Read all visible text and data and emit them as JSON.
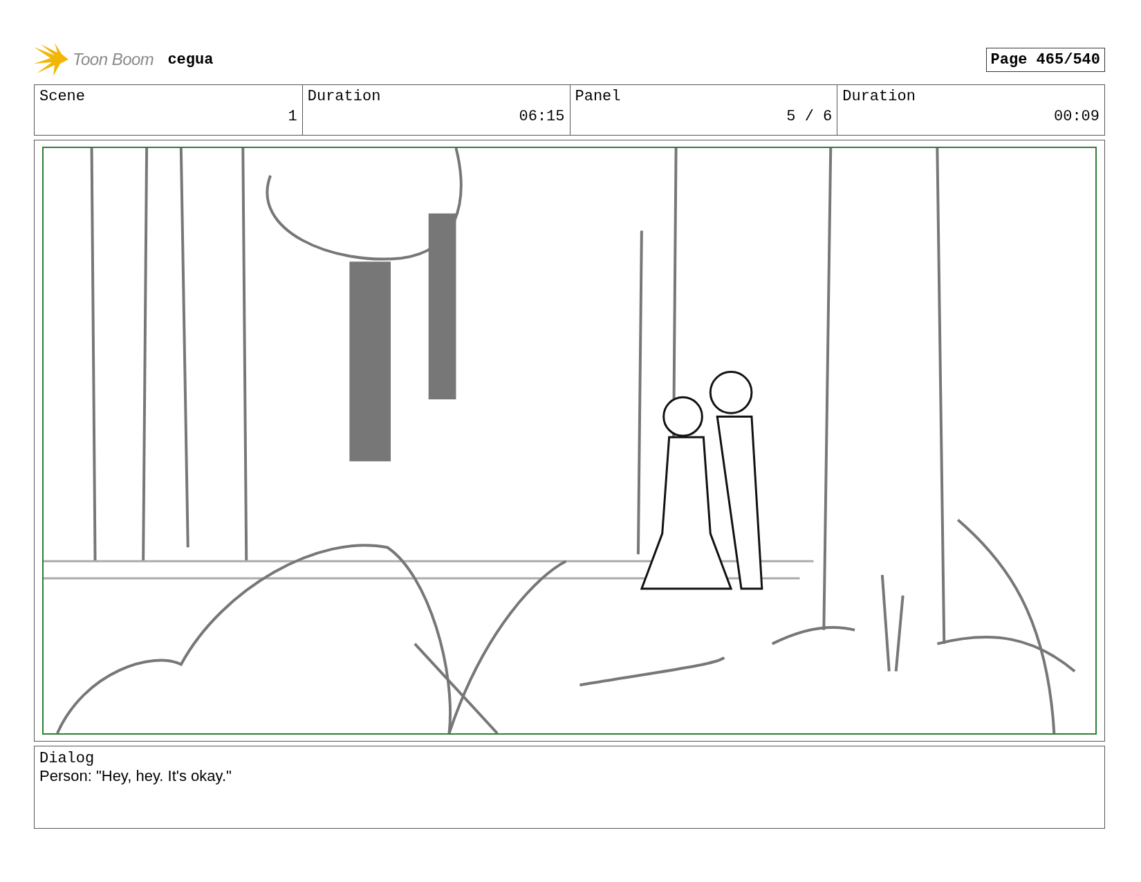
{
  "header": {
    "logo_text": "Toon Boom",
    "project": "cegua",
    "page": "Page 465/540"
  },
  "info": {
    "columns": [
      "Scene",
      "Duration",
      "Panel",
      "Duration"
    ],
    "values": [
      "1",
      "06:15",
      "5 / 6",
      "00:09"
    ]
  },
  "dialog": {
    "label": "Dialog",
    "text": "Person: \"Hey, hey. It's okay.\""
  }
}
